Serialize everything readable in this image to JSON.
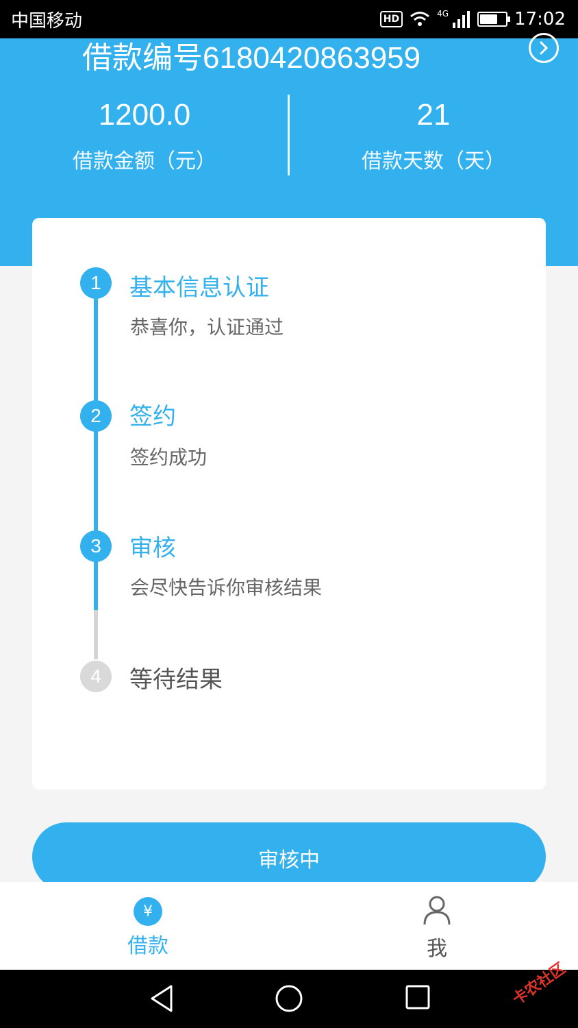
{
  "status_bar": {
    "carrier": "中国移动",
    "hd": "HD",
    "network": "4G",
    "time": "17:02",
    "battery_level": 0.7
  },
  "header": {
    "loan_number": "借款编号6180420863959",
    "amount_value": "1200.0",
    "amount_label": "借款金额（元）",
    "days_value": "21",
    "days_label": "借款天数（天）"
  },
  "steps": [
    {
      "num": "1",
      "title": "基本信息认证",
      "subtitle": "恭喜你，认证通过",
      "state": "done"
    },
    {
      "num": "2",
      "title": "签约",
      "subtitle": "签约成功",
      "state": "done"
    },
    {
      "num": "3",
      "title": "审核",
      "subtitle": "会尽快告诉你审核结果",
      "state": "current"
    },
    {
      "num": "4",
      "title": "等待结果",
      "subtitle": "",
      "state": "pending"
    }
  ],
  "action_button": {
    "label": "审核中"
  },
  "tabs": [
    {
      "label": "借款",
      "icon": "yen-icon",
      "active": true,
      "glyph": "¥"
    },
    {
      "label": "我",
      "icon": "person-icon",
      "active": false
    }
  ],
  "watermark": "卡农社区",
  "colors": {
    "accent": "#33b1ee",
    "pending": "#d9d9d9"
  }
}
